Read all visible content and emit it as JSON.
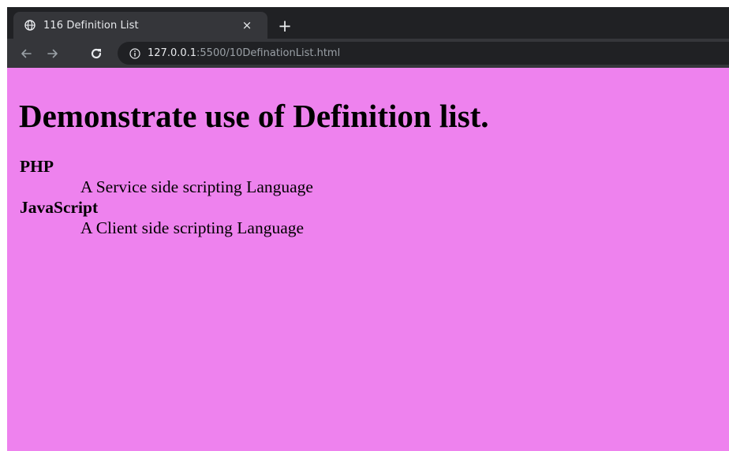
{
  "browser": {
    "tab": {
      "title": "116 Definition List",
      "close_glyph": "×",
      "favicon": "globe-icon"
    },
    "new_tab_glyph": "+",
    "toolbar": {
      "back_icon": "arrow-left-icon",
      "forward_icon": "arrow-right-icon",
      "reload_icon": "reload-icon",
      "info_icon": "info-icon"
    },
    "address": {
      "host": "127.0.0.1",
      "rest": ":5500/10DefinationList.html"
    }
  },
  "page": {
    "background": "#ee82ee",
    "heading": "Demonstrate use of Definition list.",
    "definitions": [
      {
        "term": "PHP",
        "description": "A Service side scripting Language"
      },
      {
        "term": "JavaScript",
        "description": "A Client side scripting Language"
      }
    ]
  }
}
